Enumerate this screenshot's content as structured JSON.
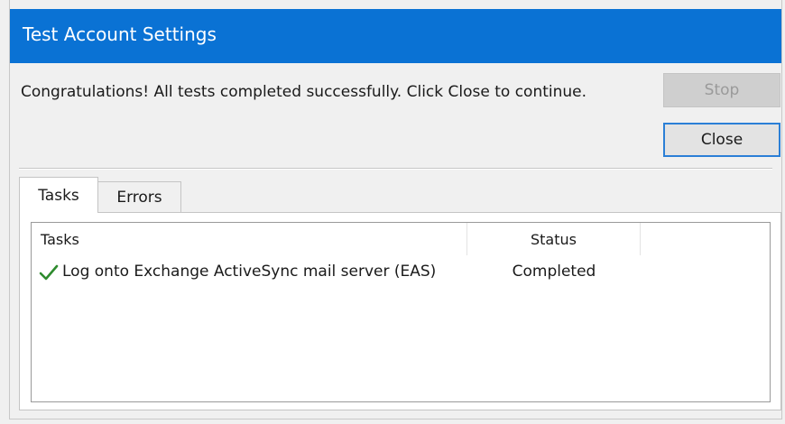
{
  "window": {
    "title": "Test Account Settings"
  },
  "message": "Congratulations! All tests completed successfully. Click Close to continue.",
  "buttons": {
    "stop_label": "Stop",
    "close_label": "Close"
  },
  "tabs": [
    {
      "label": "Tasks",
      "selected": true
    },
    {
      "label": "Errors",
      "selected": false
    }
  ],
  "table": {
    "columns": [
      "Tasks",
      "Status"
    ],
    "rows": [
      {
        "icon": "checkmark-icon",
        "task": "Log onto Exchange ActiveSync mail server (EAS)",
        "status": "Completed"
      }
    ]
  },
  "colors": {
    "title_bar": "#0a72d4",
    "checkmark": "#2e8b2e",
    "focus_border": "#2b7fd6"
  }
}
